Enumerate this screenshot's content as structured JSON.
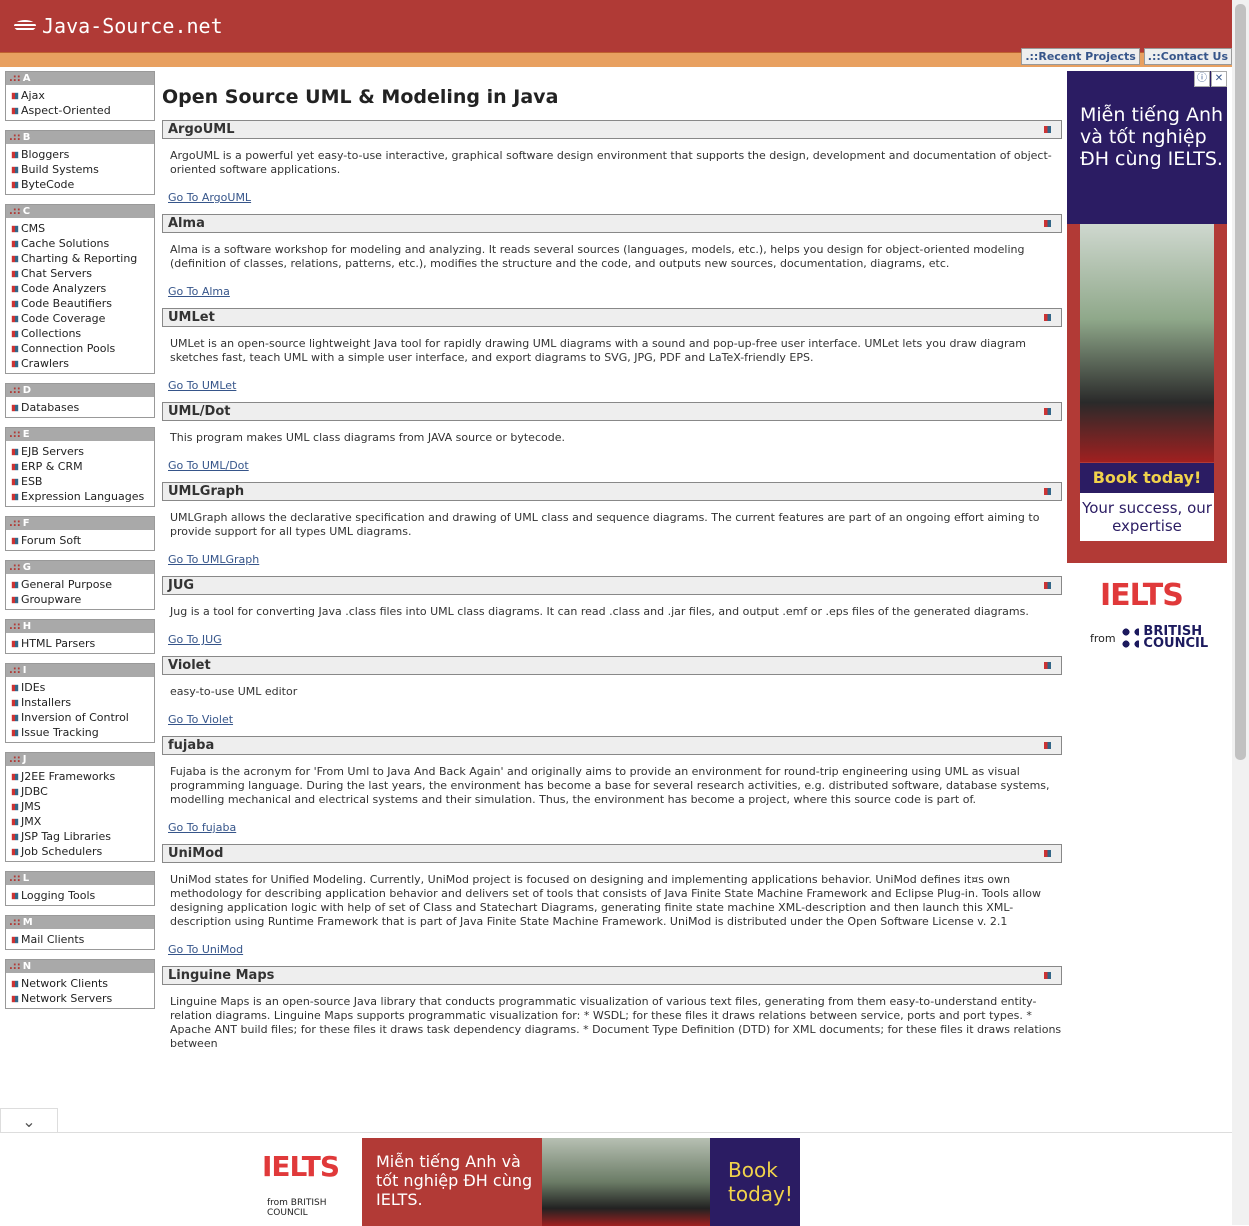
{
  "header": {
    "logo_text": "Java-Source.net",
    "links": [
      "Recent Projects",
      "Contact Us"
    ],
    "bg": "#b03a36",
    "accent": "#e8a060"
  },
  "sidebar": [
    {
      "letter": "A",
      "items": [
        "Ajax",
        "Aspect-Oriented"
      ]
    },
    {
      "letter": "B",
      "items": [
        "Bloggers",
        "Build Systems",
        "ByteCode"
      ]
    },
    {
      "letter": "C",
      "items": [
        "CMS",
        "Cache Solutions",
        "Charting & Reporting",
        "Chat Servers",
        "Code Analyzers",
        "Code Beautifiers",
        "Code Coverage",
        "Collections",
        "Connection Pools",
        "Crawlers"
      ]
    },
    {
      "letter": "D",
      "items": [
        "Databases"
      ]
    },
    {
      "letter": "E",
      "items": [
        "EJB Servers",
        "ERP & CRM",
        "ESB",
        "Expression Languages"
      ]
    },
    {
      "letter": "F",
      "items": [
        "Forum Soft"
      ]
    },
    {
      "letter": "G",
      "items": [
        "General Purpose",
        "Groupware"
      ]
    },
    {
      "letter": "H",
      "items": [
        "HTML Parsers"
      ]
    },
    {
      "letter": "I",
      "items": [
        "IDEs",
        "Installers",
        "Inversion of Control",
        "Issue Tracking"
      ]
    },
    {
      "letter": "J",
      "items": [
        "J2EE Frameworks",
        "JDBC",
        "JMS",
        "JMX",
        "JSP Tag Libraries",
        "Job Schedulers"
      ]
    },
    {
      "letter": "L",
      "items": [
        "Logging Tools"
      ]
    },
    {
      "letter": "M",
      "items": [
        "Mail Clients"
      ]
    },
    {
      "letter": "N",
      "items": [
        "Network Clients",
        "Network Servers"
      ]
    }
  ],
  "main": {
    "title": "Open Source UML & Modeling in Java",
    "projects": [
      {
        "name": "ArgoUML",
        "desc": "ArgoUML is a powerful yet easy-to-use interactive, graphical software design environment that supports the design, development and documentation of object-oriented software applications.",
        "link": "Go To ArgoUML"
      },
      {
        "name": "Alma",
        "desc": "Alma is a software workshop for modeling and analyzing. It reads several sources (languages, models, etc.), helps you design for object-oriented modeling (definition of classes, relations, patterns, etc.), modifies the structure and the code, and outputs new sources, documentation, diagrams, etc.",
        "link": "Go To Alma"
      },
      {
        "name": "UMLet",
        "desc": "UMLet is an open-source lightweight Java tool for rapidly drawing UML diagrams with a sound and pop-up-free user interface. UMLet lets you draw diagram sketches fast, teach UML with a simple user interface, and export diagrams to SVG, JPG, PDF and LaTeX-friendly EPS.",
        "link": "Go To UMLet"
      },
      {
        "name": "UML/Dot",
        "desc": "This program makes UML class diagrams from JAVA source or bytecode.",
        "link": "Go To UML/Dot"
      },
      {
        "name": "UMLGraph",
        "desc": "UMLGraph allows the declarative specification and drawing of UML class and sequence diagrams. The current features are part of an ongoing effort aiming to provide support for all types UML diagrams.",
        "link": "Go To UMLGraph"
      },
      {
        "name": "JUG",
        "desc": "Jug is a tool for converting Java .class files into UML class diagrams. It can read .class and .jar files, and output .emf or .eps files of the generated diagrams.",
        "link": "Go To JUG"
      },
      {
        "name": "Violet",
        "desc": "easy-to-use UML editor",
        "link": "Go To Violet"
      },
      {
        "name": "fujaba",
        "desc": "Fujaba is the acronym for 'From Uml to Java And Back Again' and originally aims to provide an environment for round-trip engineering using UML as visual programming language. During the last years, the environment has become a base for several research activities, e.g. distributed software, database systems, modelling mechanical and electrical systems and their simulation. Thus, the environment has become a project, where this source code is part of.",
        "link": "Go To fujaba"
      },
      {
        "name": "UniMod",
        "desc": "UniMod states for Unified Modeling. Currently, UniMod project is focused on designing and implementing applications behavior. UniMod defines it¤s own methodology for describing application behavior and delivers set of tools that consists of Java Finite State Machine Framework and Eclipse Plug-in. Tools allow designing application logic with help of set of Class and Statechart Diagrams, generating finite state machine XML-description and then launch this XML-description using Runtime Framework that is part of Java Finite State Machine Framework. UniMod is distributed under the Open Software License v. 2.1",
        "link": "Go To UniMod"
      },
      {
        "name": "Linguine Maps",
        "desc": "Linguine Maps is an open-source Java library that conducts programmatic visualization of various text files, generating from them easy-to-understand entity-relation diagrams. Linguine Maps supports programmatic visualization for: * WSDL; for these files it draws relations between service, ports and port types. * Apache ANT build files; for these files it draws task dependency diagrams. * Document Type Definition (DTD) for XML documents; for these files it draws relations between",
        "link": ""
      }
    ]
  },
  "ad_right": {
    "headline": "Miễn tiếng Anh và tốt nghiệp ĐH cùng IELTS.",
    "book": "Book today!",
    "tagline": "Your success, our expertise",
    "brand": "IELTS",
    "from": "from",
    "council": "BRITISH COUNCIL"
  },
  "ad_bottom": {
    "brand": "IELTS",
    "from": "from BRITISH COUNCIL",
    "headline": "Miễn tiếng Anh và tốt nghiệp ĐH cùng IELTS.",
    "book": "Book today!"
  }
}
